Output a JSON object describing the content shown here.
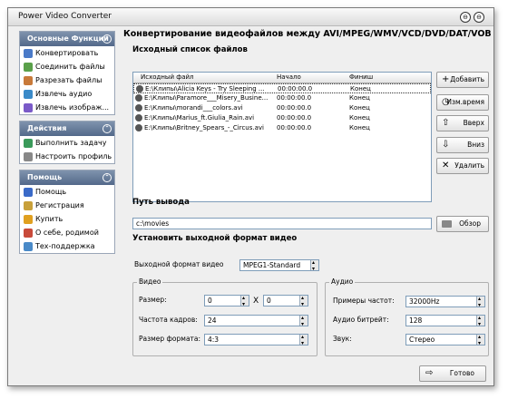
{
  "window": {
    "title": "Power Video Converter",
    "btn_min": "⊖",
    "btn_close": "⊖"
  },
  "sidebar": {
    "main": {
      "title": "Основные Функции",
      "collapse": "⌃",
      "items": [
        {
          "label": "Конвертировать",
          "icon": "convert-icon",
          "color": "#4a7ac8"
        },
        {
          "label": "Соединить файлы",
          "icon": "join-icon",
          "color": "#5aa04a"
        },
        {
          "label": "Разрезать файлы",
          "icon": "cut-icon",
          "color": "#c87a3a"
        },
        {
          "label": "Извлечь аудио",
          "icon": "audio-icon",
          "color": "#3a8ac8"
        },
        {
          "label": "Извлечь изображ...",
          "icon": "image-icon",
          "color": "#7a5ac8"
        }
      ]
    },
    "actions": {
      "title": "Действия",
      "collapse": "⌃",
      "items": [
        {
          "label": "Выполнить задачу",
          "icon": "run-icon",
          "color": "#3a9a5a"
        },
        {
          "label": "Настроить профиль",
          "icon": "profile-icon",
          "color": "#888888"
        }
      ]
    },
    "help": {
      "title": "Помощь",
      "collapse": "⌃",
      "items": [
        {
          "label": "Помощь",
          "icon": "help-icon",
          "color": "#3a6ac8"
        },
        {
          "label": "Регистрация",
          "icon": "register-icon",
          "color": "#c8a03a"
        },
        {
          "label": "Купить",
          "icon": "buy-icon",
          "color": "#e0a020"
        },
        {
          "label": "О себе, родимой",
          "icon": "about-icon",
          "color": "#c84a3a"
        },
        {
          "label": "Тех-поддержка",
          "icon": "support-icon",
          "color": "#4a8ac8"
        }
      ]
    }
  },
  "main": {
    "header": "Конвертирование видеофайлов между AVI/MPEG/WMV/VCD/DVD/DAT/VOB",
    "source_title": "Исходный список файлов",
    "columns": [
      "Исходный файл",
      "Начало",
      "Финиш"
    ],
    "files": [
      {
        "name": "E:\\Клипы\\Alicia Keys - Try Sleeping ...",
        "start": "00:00:00.0",
        "end": "Конец"
      },
      {
        "name": "E:\\Клипы\\Paramore___Misery_Busine...",
        "start": "00:00:00.0",
        "end": "Конец"
      },
      {
        "name": "E:\\Клипы\\morandi___colors.avi",
        "start": "00:00:00.0",
        "end": "Конец"
      },
      {
        "name": "E:\\Клипы\\Marius_ft.Giulia_Rain.avi",
        "start": "00:00:00.0",
        "end": "Конец"
      },
      {
        "name": "E:\\Клипы\\Britney_Spears_-_Circus.avi",
        "start": "00:00:00.0",
        "end": "Конец"
      }
    ],
    "buttons": {
      "add": {
        "label": "Добавить",
        "icon": "+"
      },
      "edit_time": {
        "label": "Изм.время",
        "icon": "◷"
      },
      "up": {
        "label": "Вверх",
        "icon": "⇧"
      },
      "down": {
        "label": "Вниз",
        "icon": "⇩"
      },
      "delete": {
        "label": "Удалить",
        "icon": "✕"
      }
    },
    "output_title": "Путь вывода",
    "output_path": "c:\\movies",
    "browse_label": "Обзор",
    "browse_icon": "folder-icon",
    "format_section_title": "Установить выходной формат видео",
    "format_label": "Выходной формат видео",
    "format_value": "MPEG1-Standard",
    "video": {
      "group": "Видео",
      "size_label": "Размер:",
      "width": "0",
      "times": "X",
      "height": "0",
      "fps_label": "Частота кадров:",
      "fps": "24",
      "aspect_label": "Размер формата:",
      "aspect": "4:3"
    },
    "audio": {
      "group": "Аудио",
      "sample_label": "Примеры частот:",
      "sample": "32000Hz",
      "bitrate_label": "Аудио битрейт:",
      "bitrate": "128",
      "sound_label": "Звук:",
      "sound": "Стерео"
    },
    "done_label": "Готово",
    "done_icon": "⇨"
  }
}
